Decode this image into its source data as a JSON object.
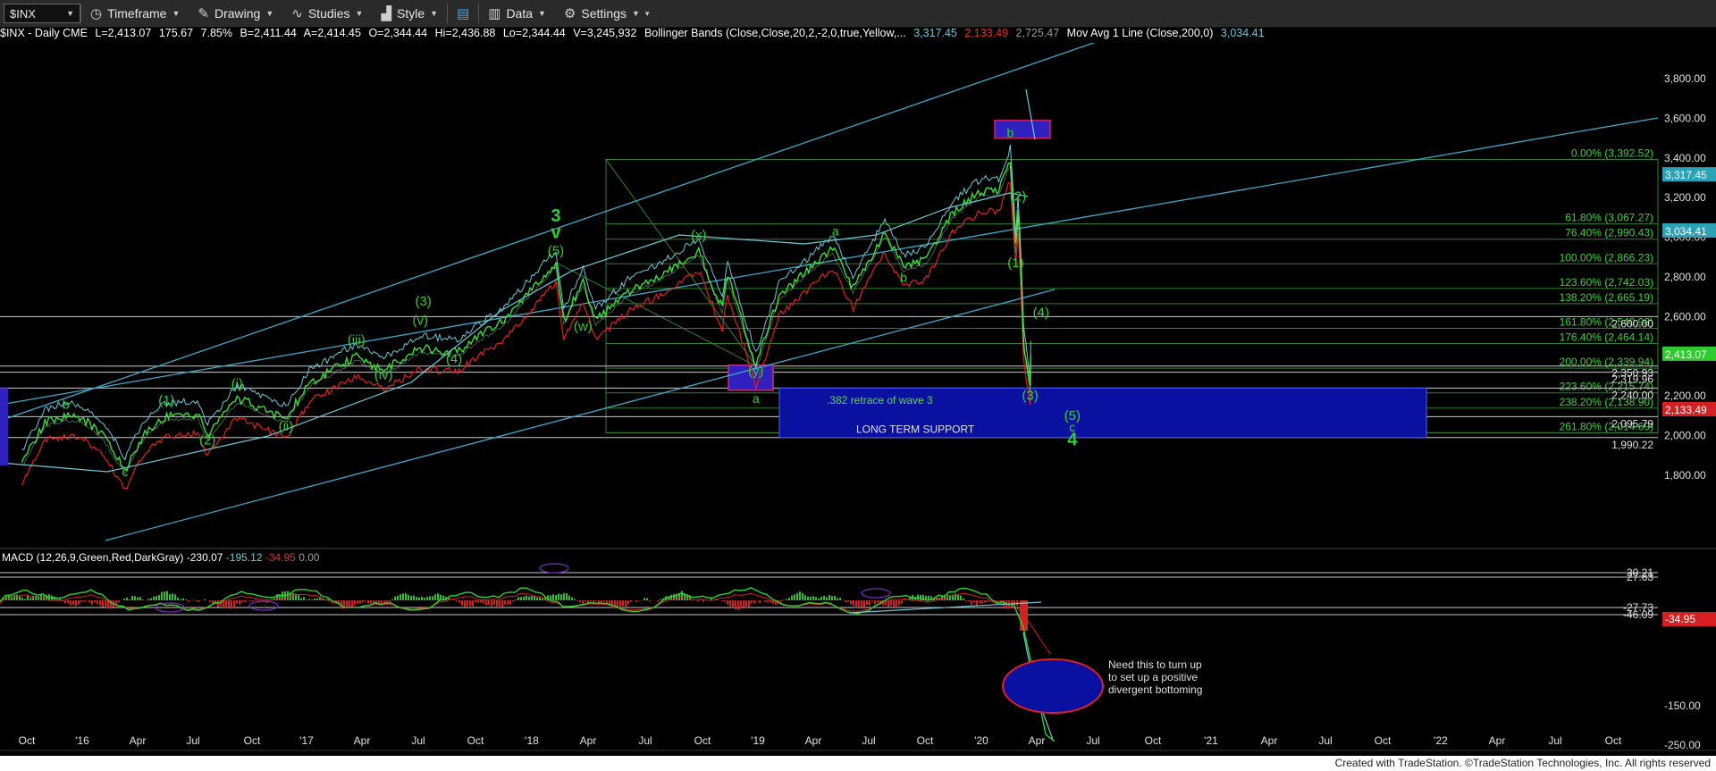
{
  "toolbar": {
    "symbol": "$INX",
    "timeframe": "Timeframe",
    "drawing": "Drawing",
    "studies": "Studies",
    "style": "Style",
    "data": "Data",
    "settings": "Settings"
  },
  "info_bar": {
    "symbol_line": "$INX - Daily  CME",
    "last": "L=2,413.07",
    "change": "175.67",
    "pct": "7.85%",
    "bid": "B=2,411.44",
    "ask": "A=2,414.45",
    "open": "O=2,344.44",
    "high": "Hi=2,436.88",
    "low": "Lo=2,344.44",
    "volume": "V=3,245,932",
    "bb_label": "Bollinger Bands (Close,Close,20,2,-2,0,true,Yellow,...",
    "bb_upper": "3,317.45",
    "bb_lower": "2,133.49",
    "bb_mid": "2,725.47",
    "ma_label": "Mov Avg 1 Line (Close,200,0)",
    "ma_value": "3,034.41",
    "macd_label": "MACD (12,26,9,Green,Red,DarkGray)",
    "macd_v1": "-230.07",
    "macd_v2": "-195.12",
    "macd_v3": "-34.95",
    "macd_v4": "0.00"
  },
  "footer": "Created with TradeStation. ©TradeStation Technologies, Inc. All rights reserved",
  "colors": {
    "price": "#3cdc3c",
    "upper_band": "#6cc8d8",
    "lower_band": "#e02020",
    "channel": "#3fa9c9",
    "wave_label": "#2fd12f",
    "fib": "#2f7f2f",
    "support_box": "#0a10a0",
    "highlight_box": "#3020c0",
    "last_tag": "#2ecc2e",
    "down_tag": "#d42020",
    "ma_tag": "#2aa3b8"
  },
  "chart_data": {
    "type": "line",
    "title": "$INX - Daily",
    "x_ticks": [
      "Oct",
      "'16",
      "Apr",
      "Jul",
      "Oct",
      "'17",
      "Apr",
      "Jul",
      "Oct",
      "'18",
      "Apr",
      "Jul",
      "Oct",
      "'19",
      "Apr",
      "Jul",
      "Oct",
      "'20",
      "Apr",
      "Jul",
      "Oct",
      "'21",
      "Apr",
      "Jul",
      "Oct",
      "'22",
      "Apr",
      "Jul",
      "Oct"
    ],
    "price_axis": {
      "ticks": [
        "3,800.00",
        "3,600.00",
        "3,400.00",
        "3,200.00",
        "3,000.00",
        "2,800.00",
        "2,600.00",
        "2,400.00",
        "2,200.00",
        "2,000.00",
        "1,800.00"
      ],
      "range": [
        1800,
        3800
      ]
    },
    "macd_axis": {
      "ticks": [
        "-150.00",
        "-250.00"
      ],
      "labels": [
        "30.21",
        "27.63",
        "-27.73",
        "-46.09",
        "-34.95"
      ]
    },
    "series": [
      {
        "name": "$INX",
        "x": [
          "2015-08-24",
          "2015-10-01",
          "2015-11-05",
          "2015-12-01",
          "2016-01-04",
          "2016-02-11",
          "2016-03-15",
          "2016-04-20",
          "2016-06-10",
          "2016-06-27",
          "2016-08-15",
          "2016-11-04",
          "2016-12-13",
          "2017-03-01",
          "2017-04-15",
          "2017-06-15",
          "2017-08-15",
          "2017-09-20",
          "2017-11-01",
          "2018-01-26",
          "2018-02-08",
          "2018-03-12",
          "2018-04-02",
          "2018-06-01",
          "2018-07-15",
          "2018-09-20",
          "2018-10-29",
          "2018-11-07",
          "2018-12-24",
          "2019-01-31",
          "2019-04-30",
          "2019-06-03",
          "2019-07-26",
          "2019-08-26",
          "2019-10-03",
          "2019-11-15",
          "2019-12-31",
          "2020-01-31",
          "2020-02-19",
          "2020-02-28",
          "2020-03-03",
          "2020-03-06",
          "2020-03-12",
          "2020-03-16",
          "2020-03-23",
          "2020-03-24"
        ],
        "values": [
          1867,
          2070,
          2100,
          2090,
          2010,
          1829,
          2020,
          2100,
          2110,
          2000,
          2190,
          2085,
          2270,
          2400,
          2330,
          2440,
          2420,
          2500,
          2580,
          2873,
          2580,
          2780,
          2581,
          2740,
          2800,
          2930,
          2640,
          2810,
          2351,
          2705,
          2945,
          2745,
          3025,
          2850,
          2890,
          3120,
          3230,
          3230,
          3386,
          2950,
          3130,
          2970,
          2480,
          2390,
          2237,
          2413
        ]
      },
      {
        "name": "Bollinger upper",
        "values": [
          3317.45
        ]
      },
      {
        "name": "Bollinger lower",
        "values": [
          2133.49
        ]
      },
      {
        "name": "Mov Avg 200",
        "values": [
          3034.41
        ]
      }
    ],
    "fib_levels": [
      {
        "label": "0.00% (3,392.52)",
        "value": 3392.52
      },
      {
        "label": "61.80% (3,067.27)",
        "value": 3067.27
      },
      {
        "label": "76.40% (2,990.43)",
        "value": 2990.43
      },
      {
        "label": "100.00% (2,866.23)",
        "value": 2866.23
      },
      {
        "label": "123.60% (2,742.03)",
        "value": 2742.03
      },
      {
        "label": "138.20% (2,665.19)",
        "value": 2665.19
      },
      {
        "label": "161.80% (2,540.98)",
        "value": 2540.98
      },
      {
        "label": "176.40% (2,464.14)",
        "value": 2464.14
      },
      {
        "label": "200.00% (2,339.94)",
        "value": 2339.94
      },
      {
        "label": "223.60% (2,215.74)",
        "value": 2215.74
      },
      {
        "label": "238.20% (2,138.90)",
        "value": 2138.9
      },
      {
        "label": "261.80% (2,014.69)",
        "value": 2014.69
      }
    ],
    "horizontal_levels": [
      {
        "label": "2,600.00",
        "value": 2600
      },
      {
        "label": "2,350.93",
        "value": 2350.93
      },
      {
        "label": "2,319.96",
        "value": 2319.96
      },
      {
        "label": "2,240.00",
        "value": 2240
      },
      {
        "label": "2,095.79",
        "value": 2095.79
      },
      {
        "label": "1,990.22",
        "value": 1990.22
      }
    ],
    "price_tags": [
      {
        "label": "3,317.45",
        "value": 3317.45,
        "role": "band"
      },
      {
        "label": "3,034.41",
        "value": 3034.41,
        "role": "ma"
      },
      {
        "label": "2,413.07",
        "value": 2413.07,
        "role": "last"
      },
      {
        "label": "2,133.49",
        "value": 2133.49,
        "role": "down"
      }
    ],
    "wave_labels": [
      {
        "text": "c",
        "x": "2016-02-11",
        "y": 1795
      },
      {
        "text": "b",
        "x": "2015-11-05",
        "y": 2135
      },
      {
        "text": "(1)",
        "x": "2016-04-20",
        "y": 2155
      },
      {
        "text": "(2)",
        "x": "2016-06-27",
        "y": 1955
      },
      {
        "text": "(i)",
        "x": "2016-08-15",
        "y": 2240
      },
      {
        "text": "(ii)",
        "x": "2016-11-04",
        "y": 2025
      },
      {
        "text": "(iii)",
        "x": "2017-03-01",
        "y": 2460
      },
      {
        "text": "(iv)",
        "x": "2017-04-15",
        "y": 2285
      },
      {
        "text": "(v)",
        "x": "2017-06-15",
        "y": 2560
      },
      {
        "text": "(3)",
        "x": "2017-06-20",
        "y": 2655
      },
      {
        "text": "(4)",
        "x": "2017-08-10",
        "y": 2365
      },
      {
        "text": "(5)",
        "x": "2018-01-26",
        "y": 2910
      },
      {
        "text": "v",
        "x": "2018-01-26",
        "y": 2995
      },
      {
        "text": "3",
        "x": "2018-01-26",
        "y": 3080
      },
      {
        "text": "(w)",
        "x": "2018-03-12",
        "y": 2530
      },
      {
        "text": "(x)",
        "x": "2018-09-20",
        "y": 2990
      },
      {
        "text": "(y)",
        "x": "2018-12-24",
        "y": 2305
      },
      {
        "text": "a",
        "x": "2018-12-24",
        "y": 2165
      },
      {
        "text": "a",
        "x": "2019-05-05",
        "y": 3010
      },
      {
        "text": "b",
        "x": "2019-08-26",
        "y": 2775
      },
      {
        "text": "b",
        "x": "2020-02-19",
        "y": 3505
      },
      {
        "text": "(2)",
        "x": "2020-03-03",
        "y": 3185
      },
      {
        "text": "(1)",
        "x": "2020-02-28",
        "y": 2850
      },
      {
        "text": "(4)",
        "x": "2020-04-10",
        "y": 2600
      },
      {
        "text": "(3)",
        "x": "2020-03-23",
        "y": 2180
      },
      {
        "text": "(5)",
        "x": "2020-06-01",
        "y": 2080
      },
      {
        "text": "c",
        "x": "2020-06-01",
        "y": 2020
      },
      {
        "text": "4",
        "x": "2020-06-01",
        "y": 1950
      }
    ],
    "annotations": [
      {
        "text": ".382 retrace of wave 3"
      },
      {
        "text": "LONG TERM SUPPORT"
      },
      {
        "text": "Need this to turn up\nto set up a positive\ndivergent bottoming"
      }
    ]
  }
}
